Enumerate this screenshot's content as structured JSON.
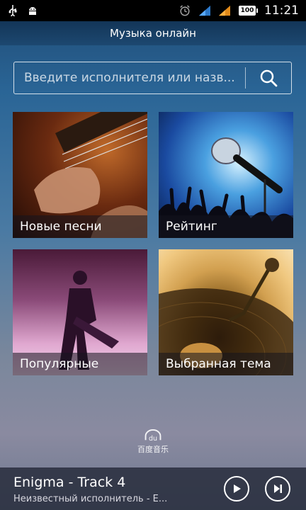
{
  "status_bar": {
    "time": "11:21",
    "battery": "100",
    "icons": [
      "usb-icon",
      "android-debug-icon",
      "alarm-icon",
      "signal-icon",
      "signal-icon",
      "battery-icon"
    ]
  },
  "header": {
    "title": "Музыка онлайн"
  },
  "search": {
    "placeholder": "Введите исполнителя или назв...",
    "icon": "search-icon"
  },
  "tiles": [
    {
      "label": "Новые песни"
    },
    {
      "label": "Рейтинг"
    },
    {
      "label": "Популярные"
    },
    {
      "label": "Выбранная тема"
    }
  ],
  "logo": {
    "text": "百度音乐"
  },
  "player": {
    "title": "Enigma - Track  4",
    "artist": "Неизвестный исполнитель - E...",
    "play_icon": "play-icon",
    "next_icon": "next-track-icon"
  },
  "colors": {
    "status_bar": "#000000",
    "text": "#ffffff"
  }
}
